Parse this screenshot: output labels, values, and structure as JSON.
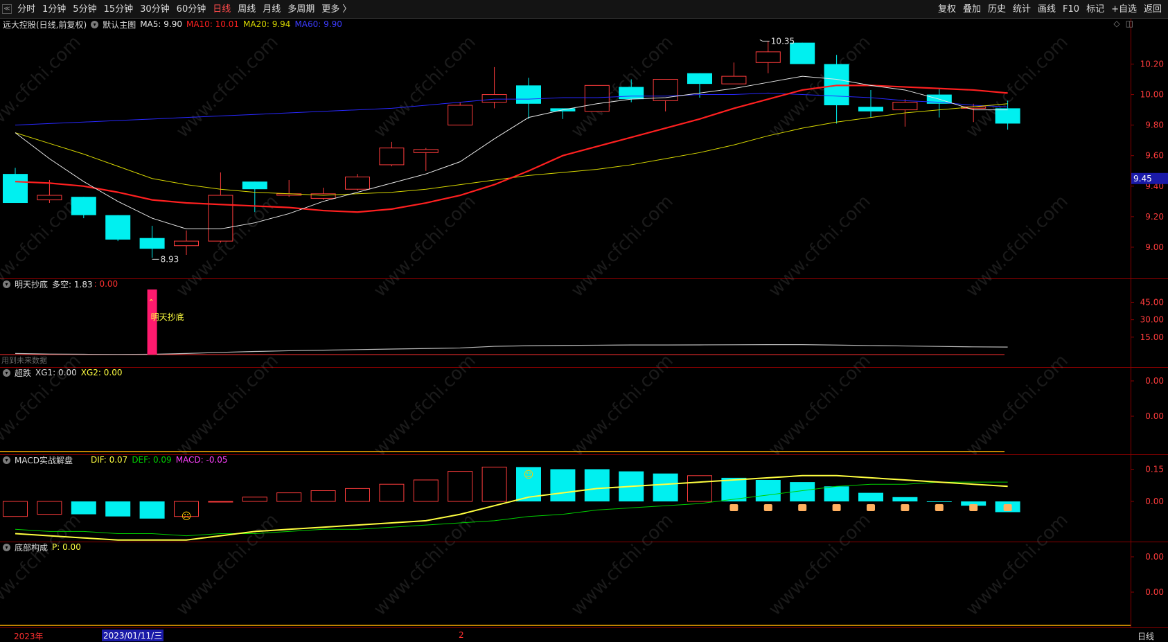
{
  "toolbar": {
    "collapse_glyph": "≪",
    "periods": [
      {
        "label": "分时",
        "active": false
      },
      {
        "label": "1分钟",
        "active": false
      },
      {
        "label": "5分钟",
        "active": false
      },
      {
        "label": "15分钟",
        "active": false
      },
      {
        "label": "30分钟",
        "active": false
      },
      {
        "label": "60分钟",
        "active": false
      },
      {
        "label": "日线",
        "active": true
      },
      {
        "label": "周线",
        "active": false
      },
      {
        "label": "月线",
        "active": false
      },
      {
        "label": "多周期",
        "active": false
      },
      {
        "label": "更多 〉",
        "active": false
      }
    ],
    "tools": [
      "复权",
      "叠加",
      "历史",
      "统计",
      "画线",
      "F10",
      "标记",
      "+自选",
      "返回"
    ]
  },
  "main_chart": {
    "stock_name": "远大控股(日线,前复权)",
    "template": "默认主图",
    "ma5": "MA5: 9.90",
    "ma10": "MA10: 10.01",
    "ma20": "MA20: 9.94",
    "ma60": "MA60: 9.90",
    "high_label": "10.35",
    "low_label": "8.93",
    "current_price": "9.45",
    "y_ticks": [
      "10.20",
      "10.00",
      "9.80",
      "9.60",
      "9.40",
      "9.20",
      "9.00"
    ],
    "icons": [
      "diamond-icon",
      "window-icon"
    ]
  },
  "panel_dibottom": {
    "name": "明天抄底",
    "label": "多空: 1.83",
    "value": ": 0.00",
    "signal_text": "明天抄底",
    "note": "用到未来数据",
    "y_ticks": [
      "45.00",
      "30.00",
      "15.00"
    ]
  },
  "panel_chaodie": {
    "name": "超跌",
    "xg1": "XG1: 0.00",
    "xg2": "XG2: 0.00",
    "y_ticks": [
      "0.00",
      "0.00"
    ]
  },
  "panel_macd": {
    "name": "MACD实战解盘",
    "dif": "DIF: 0.07",
    "def": "DEF: 0.09",
    "macd": "MACD: -0.05",
    "y_ticks": [
      "0.15",
      "0.00"
    ]
  },
  "panel_bottom": {
    "name": "底部构成",
    "p": "P: 0.00",
    "y_ticks": [
      "0.00",
      "0.00"
    ]
  },
  "bottom_bar": {
    "year": "2023年",
    "date": "2023/01/11/三",
    "month_mark": "2",
    "period": "日线"
  },
  "watermark": "www.cfchi.com",
  "colors": {
    "up": "#ff3c3c",
    "down": "#00f0f0",
    "ma5": "#e8e8e8",
    "ma10": "#ff2020",
    "ma20": "#d8d800",
    "ma60": "#2828ff",
    "dif": "#ffff40",
    "def": "#00d000",
    "macd": "#ff40ff"
  },
  "chart_data": {
    "type": "candlestick",
    "ylim": [
      8.85,
      10.42
    ],
    "candles": [
      {
        "o": 9.48,
        "h": 9.52,
        "l": 9.29,
        "c": 9.29
      },
      {
        "o": 9.31,
        "h": 9.44,
        "l": 9.29,
        "c": 9.34
      },
      {
        "o": 9.33,
        "h": 9.33,
        "l": 9.19,
        "c": 9.21
      },
      {
        "o": 9.21,
        "h": 9.21,
        "l": 9.04,
        "c": 9.05
      },
      {
        "o": 9.06,
        "h": 9.14,
        "l": 8.93,
        "c": 8.99
      },
      {
        "o": 9.01,
        "h": 9.11,
        "l": 8.95,
        "c": 9.04
      },
      {
        "o": 9.04,
        "h": 9.49,
        "l": 9.03,
        "c": 9.34
      },
      {
        "o": 9.43,
        "h": 9.43,
        "l": 9.23,
        "c": 9.38
      },
      {
        "o": 9.34,
        "h": 9.44,
        "l": 9.33,
        "c": 9.35
      },
      {
        "o": 9.32,
        "h": 9.39,
        "l": 9.31,
        "c": 9.35
      },
      {
        "o": 9.38,
        "h": 9.48,
        "l": 9.37,
        "c": 9.46
      },
      {
        "o": 9.54,
        "h": 9.69,
        "l": 9.53,
        "c": 9.65
      },
      {
        "o": 9.62,
        "h": 9.65,
        "l": 9.5,
        "c": 9.64
      },
      {
        "o": 9.8,
        "h": 9.95,
        "l": 9.8,
        "c": 9.93
      },
      {
        "o": 9.95,
        "h": 10.18,
        "l": 9.91,
        "c": 10.0
      },
      {
        "o": 10.06,
        "h": 10.11,
        "l": 9.84,
        "c": 9.94
      },
      {
        "o": 9.91,
        "h": 9.91,
        "l": 9.84,
        "c": 9.89
      },
      {
        "o": 9.89,
        "h": 10.06,
        "l": 9.89,
        "c": 10.06
      },
      {
        "o": 10.05,
        "h": 10.1,
        "l": 9.95,
        "c": 9.97
      },
      {
        "o": 9.96,
        "h": 10.1,
        "l": 9.89,
        "c": 10.1
      },
      {
        "o": 10.14,
        "h": 10.14,
        "l": 9.98,
        "c": 10.07
      },
      {
        "o": 10.07,
        "h": 10.21,
        "l": 10.07,
        "c": 10.12
      },
      {
        "o": 10.21,
        "h": 10.35,
        "l": 10.14,
        "c": 10.28
      },
      {
        "o": 10.34,
        "h": 10.34,
        "l": 10.2,
        "c": 10.2
      },
      {
        "o": 10.2,
        "h": 10.26,
        "l": 9.81,
        "c": 9.93
      },
      {
        "o": 9.92,
        "h": 10.03,
        "l": 9.85,
        "c": 9.89
      },
      {
        "o": 9.9,
        "h": 9.97,
        "l": 9.79,
        "c": 9.95
      },
      {
        "o": 10.0,
        "h": 10.04,
        "l": 9.85,
        "c": 9.94
      },
      {
        "o": 9.91,
        "h": 9.94,
        "l": 9.82,
        "c": 9.92
      },
      {
        "o": 9.91,
        "h": 9.96,
        "l": 9.77,
        "c": 9.81
      }
    ],
    "ma5": [
      9.75,
      9.58,
      9.43,
      9.3,
      9.19,
      9.12,
      9.12,
      9.16,
      9.22,
      9.3,
      9.36,
      9.42,
      9.48,
      9.56,
      9.71,
      9.85,
      9.9,
      9.94,
      9.97,
      9.98,
      10.01,
      10.04,
      10.08,
      10.12,
      10.1,
      10.06,
      10.03,
      9.97,
      9.9,
      9.9
    ],
    "ma10": [
      9.43,
      9.42,
      9.4,
      9.36,
      9.31,
      9.29,
      9.28,
      9.27,
      9.26,
      9.24,
      9.23,
      9.25,
      9.29,
      9.34,
      9.41,
      9.5,
      9.6,
      9.66,
      9.72,
      9.78,
      9.84,
      9.91,
      9.97,
      10.03,
      10.06,
      10.06,
      10.05,
      10.04,
      10.03,
      10.01
    ],
    "ma20": [
      9.75,
      9.68,
      9.61,
      9.53,
      9.45,
      9.41,
      9.38,
      9.36,
      9.35,
      9.34,
      9.35,
      9.36,
      9.38,
      9.41,
      9.44,
      9.47,
      9.49,
      9.51,
      9.54,
      9.58,
      9.62,
      9.67,
      9.73,
      9.78,
      9.82,
      9.85,
      9.88,
      9.9,
      9.92,
      9.94
    ],
    "ma60": [
      9.8,
      9.81,
      9.82,
      9.83,
      9.84,
      9.85,
      9.86,
      9.87,
      9.88,
      9.89,
      9.9,
      9.91,
      9.93,
      9.95,
      9.97,
      9.97,
      9.98,
      9.98,
      9.99,
      9.99,
      10.0,
      10.0,
      10.01,
      10.0,
      9.99,
      9.98,
      9.96,
      9.95,
      9.93,
      9.92
    ],
    "duokong": [
      1.0,
      0.5,
      0.3,
      0.2,
      0.3,
      1.0,
      2.0,
      2.8,
      3.5,
      4.0,
      4.5,
      5.0,
      5.5,
      6.0,
      7.5,
      8.0,
      8.3,
      8.5,
      8.7,
      8.7,
      8.8,
      8.9,
      9.0,
      9.0,
      8.6,
      8.2,
      7.8,
      7.4,
      7.0,
      6.8
    ],
    "dibottom_signal_index": 4,
    "dibottom_signal_value": 56,
    "macd_hist": [
      -0.07,
      -0.06,
      -0.06,
      -0.07,
      -0.08,
      -0.07,
      0.0,
      0.02,
      0.04,
      0.05,
      0.06,
      0.08,
      0.1,
      0.14,
      0.16,
      0.16,
      0.15,
      0.15,
      0.14,
      0.13,
      0.12,
      0.11,
      0.1,
      0.09,
      0.07,
      0.04,
      0.02,
      0.0,
      -0.02,
      -0.05
    ],
    "dif": [
      -0.15,
      -0.16,
      -0.17,
      -0.18,
      -0.18,
      -0.18,
      -0.16,
      -0.14,
      -0.13,
      -0.12,
      -0.11,
      -0.1,
      -0.09,
      -0.06,
      -0.02,
      0.02,
      0.04,
      0.06,
      0.07,
      0.08,
      0.09,
      0.1,
      0.11,
      0.12,
      0.12,
      0.11,
      0.1,
      0.09,
      0.08,
      0.07
    ],
    "def": [
      -0.13,
      -0.14,
      -0.14,
      -0.15,
      -0.15,
      -0.16,
      -0.15,
      -0.15,
      -0.14,
      -0.13,
      -0.13,
      -0.12,
      -0.11,
      -0.1,
      -0.09,
      -0.07,
      -0.06,
      -0.04,
      -0.03,
      -0.02,
      -0.01,
      0.01,
      0.03,
      0.05,
      0.07,
      0.08,
      0.08,
      0.09,
      0.09,
      0.09
    ]
  }
}
